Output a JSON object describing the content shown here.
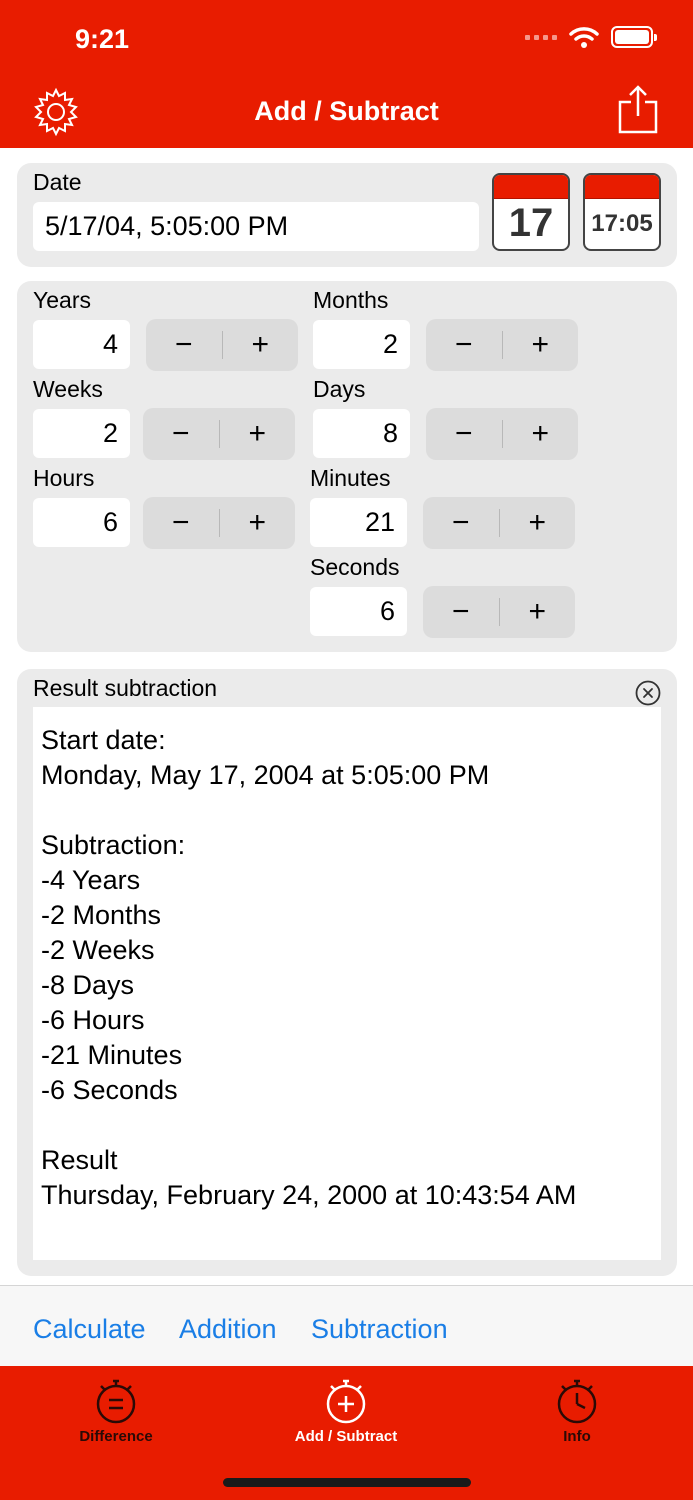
{
  "status": {
    "time": "9:21"
  },
  "nav": {
    "title": "Add / Subtract",
    "left_icon": "gear-icon",
    "right_icon": "share-icon"
  },
  "date_panel": {
    "label": "Date",
    "value": "5/17/04, 5:05:00 PM",
    "date_button_text": "17",
    "time_button_text": "17:05"
  },
  "fields": {
    "years": {
      "label": "Years",
      "value": "4"
    },
    "months": {
      "label": "Months",
      "value": "2"
    },
    "weeks": {
      "label": "Weeks",
      "value": "2"
    },
    "days": {
      "label": "Days",
      "value": "8"
    },
    "hours": {
      "label": "Hours",
      "value": "6"
    },
    "minutes": {
      "label": "Minutes",
      "value": "21"
    },
    "seconds": {
      "label": "Seconds",
      "value": "6"
    }
  },
  "stepper": {
    "minus": "−",
    "plus": "+"
  },
  "result": {
    "title": "Result subtraction",
    "lines": [
      "Start date:",
      "Monday, May 17, 2004 at 5:05:00 PM",
      "",
      "Subtraction:",
      "-4 Years",
      "-2 Months",
      "-2 Weeks",
      "-8 Days",
      "-6 Hours",
      "-21 Minutes",
      "-6 Seconds",
      "",
      "Result",
      "Thursday, February 24, 2000 at 10:43:54 AM"
    ]
  },
  "toolbar": {
    "calculate": "Calculate",
    "addition": "Addition",
    "subtraction": "Subtraction"
  },
  "tabs": [
    {
      "label": "Difference",
      "icon": "stopwatch-equals-icon",
      "active": false
    },
    {
      "label": "Add / Subtract",
      "icon": "stopwatch-plus-icon",
      "active": true
    },
    {
      "label": "Info",
      "icon": "stopwatch-icon",
      "active": false
    }
  ],
  "colors": {
    "brand_red": "#e81c00",
    "link_blue": "#1a7ee6",
    "panel_gray": "#ebebeb",
    "tab_inactive": "#2a0a06"
  }
}
